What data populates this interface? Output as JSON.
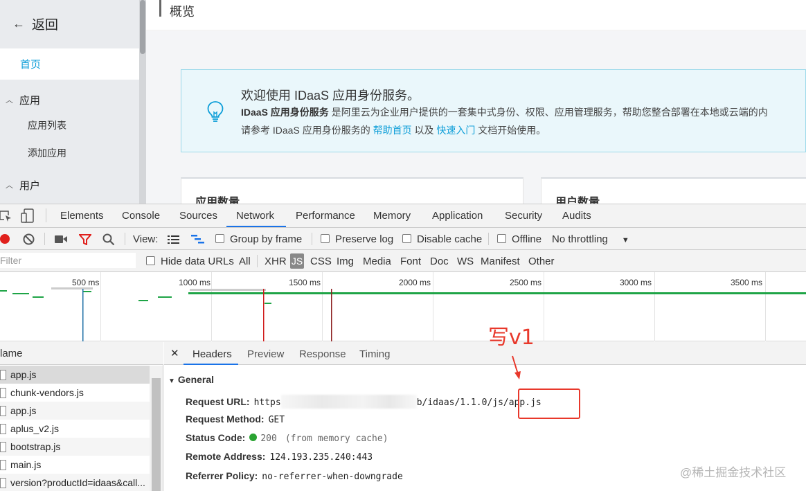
{
  "sidebar": {
    "back_label": "返回",
    "home_label": "首页",
    "groups": [
      {
        "label": "应用",
        "items": [
          "应用列表",
          "添加应用"
        ]
      },
      {
        "label": "用户",
        "items": []
      }
    ]
  },
  "main": {
    "page_title": "概览",
    "welcome": {
      "title": "欢迎使用 IDaaS 应用身份服务。",
      "desc_bold": "IDaaS 应用身份服务",
      "desc_rest": " 是阿里云为企业用户提供的一套集中式身份、权限、应用管理服务，帮助您整合部署在本地或云端的内",
      "line3_pre": "请参考 IDaaS 应用身份服务的 ",
      "link_help": "帮助首页",
      "line3_mid": " 以及 ",
      "link_quick": "快速入门",
      "line3_post": " 文档开始使用。"
    },
    "cards": [
      "应用数量",
      "用户数量"
    ]
  },
  "devtools": {
    "tabs": [
      "Elements",
      "Console",
      "Sources",
      "Network",
      "Performance",
      "Memory",
      "Application",
      "Security",
      "Audits"
    ],
    "active_tab": "Network",
    "toolbar": {
      "view_label": "View:",
      "group_by_frame": "Group by frame",
      "preserve_log": "Preserve log",
      "disable_cache": "Disable cache",
      "offline": "Offline",
      "throttling": "No throttling"
    },
    "filter": {
      "placeholder": "Filter",
      "hide_data_urls": "Hide data URLs",
      "types": [
        "All",
        "XHR",
        "JS",
        "CSS",
        "Img",
        "Media",
        "Font",
        "Doc",
        "WS",
        "Manifest",
        "Other"
      ],
      "active_type": "JS"
    },
    "overview_ticks": [
      "500 ms",
      "1000 ms",
      "1500 ms",
      "2000 ms",
      "2500 ms",
      "3000 ms",
      "3500 ms"
    ],
    "list_header": "lame",
    "requests": [
      "app.js",
      "chunk-vendors.js",
      "app.js",
      "aplus_v2.js",
      "bootstrap.js",
      "main.js",
      "version?productId=idaas&call..."
    ],
    "detail_tabs": [
      "Headers",
      "Preview",
      "Response",
      "Timing"
    ],
    "general": {
      "title": "General",
      "request_url_label": "Request URL:",
      "request_url_prefix": "https",
      "request_url_path": "b/idaas/1.1.0/js/app.js",
      "method_label": "Request Method:",
      "method": "GET",
      "status_label": "Status Code:",
      "status": "200",
      "status_note": "(from memory cache)",
      "remote_label": "Remote Address:",
      "remote": "124.193.235.240:443",
      "referrer_label": "Referrer Policy:",
      "referrer": "no-referrer-when-downgrade"
    }
  },
  "annotation": {
    "text": "写v1",
    "color": "#e8382b"
  },
  "watermark": "@稀土掘金技术社区",
  "colors": {
    "accent": "#0d9ed8",
    "devtools_blue": "#1a73e8",
    "status_green": "#2aa332"
  }
}
